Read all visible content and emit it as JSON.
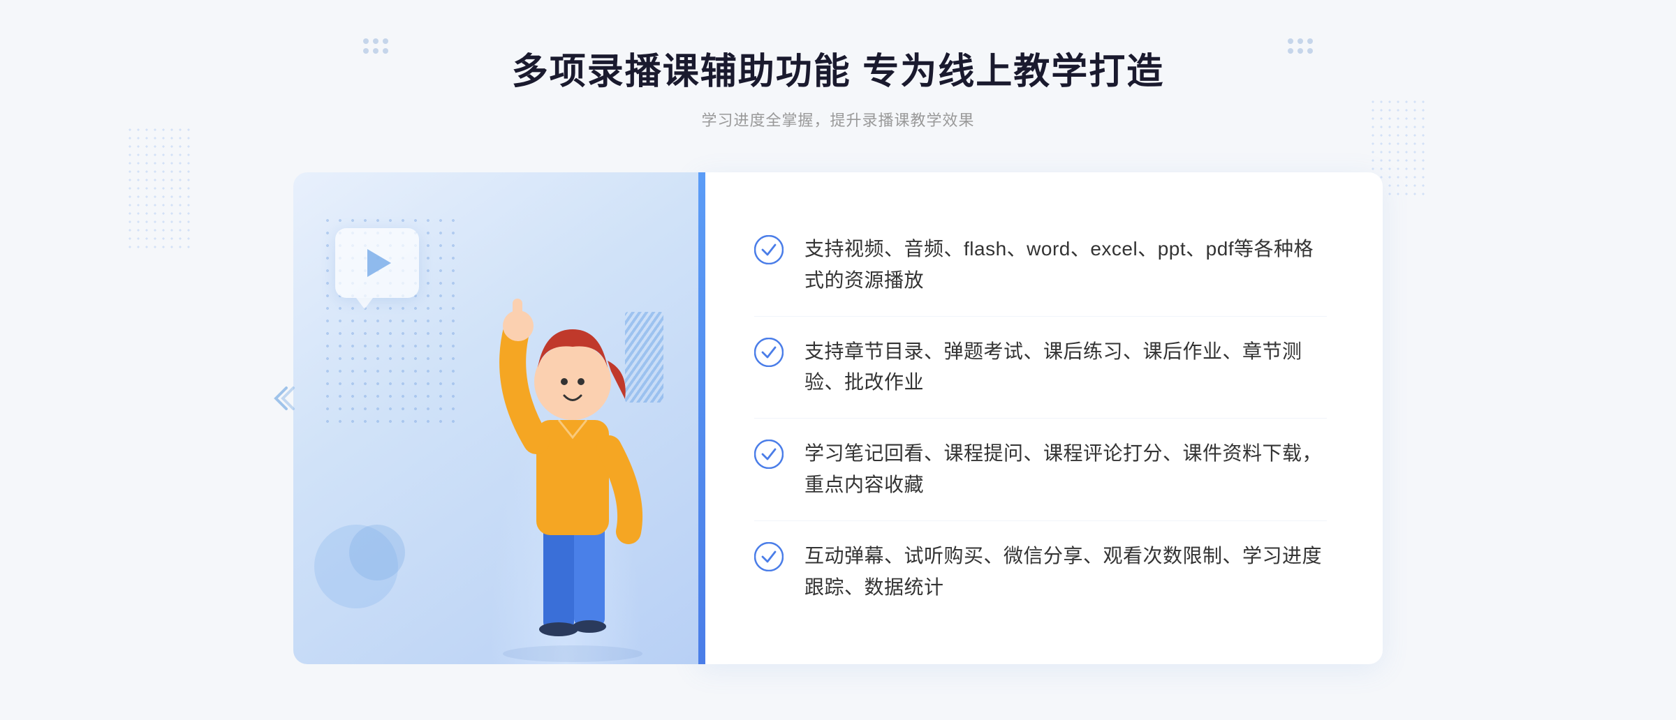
{
  "header": {
    "title": "多项录播课辅助功能 专为线上教学打造",
    "subtitle": "学习进度全掌握，提升录播课教学效果"
  },
  "features": [
    {
      "id": "feature-1",
      "text": "支持视频、音频、flash、word、excel、ppt、pdf等各种格式的资源播放"
    },
    {
      "id": "feature-2",
      "text": "支持章节目录、弹题考试、课后练习、课后作业、章节测验、批改作业"
    },
    {
      "id": "feature-3",
      "text": "学习笔记回看、课程提问、课程评论打分、课件资料下载，重点内容收藏"
    },
    {
      "id": "feature-4",
      "text": "互动弹幕、试听购买、微信分享、观看次数限制、学习进度跟踪、数据统计"
    }
  ],
  "icons": {
    "check": "✓",
    "play": "▶"
  },
  "colors": {
    "accent_blue": "#4a7de8",
    "light_blue": "#5b9cf6",
    "text_dark": "#333333",
    "text_gray": "#999999"
  }
}
